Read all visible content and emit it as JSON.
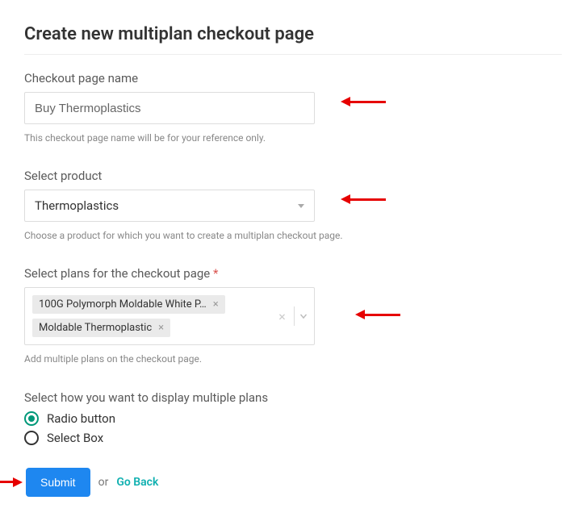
{
  "page": {
    "title": "Create new multiplan checkout page"
  },
  "fields": {
    "name": {
      "label": "Checkout page name",
      "value": "Buy Thermoplastics",
      "helper": "This checkout page name will be for your reference only."
    },
    "product": {
      "label": "Select product",
      "selected": "Thermoplastics",
      "helper": "Choose a product for which you want to create a multiplan checkout page."
    },
    "plans": {
      "label": "Select plans for the checkout page",
      "required_mark": "*",
      "chips": [
        "100G Polymorph Moldable White P…",
        "Moldable Thermoplastic"
      ],
      "helper": "Add multiple plans on the checkout page."
    },
    "display": {
      "label": "Select how you want to display multiple plans",
      "options": {
        "radio": "Radio button",
        "select": "Select Box"
      },
      "selected": "radio"
    }
  },
  "actions": {
    "submit": "Submit",
    "or": "or",
    "goback": "Go Back"
  }
}
